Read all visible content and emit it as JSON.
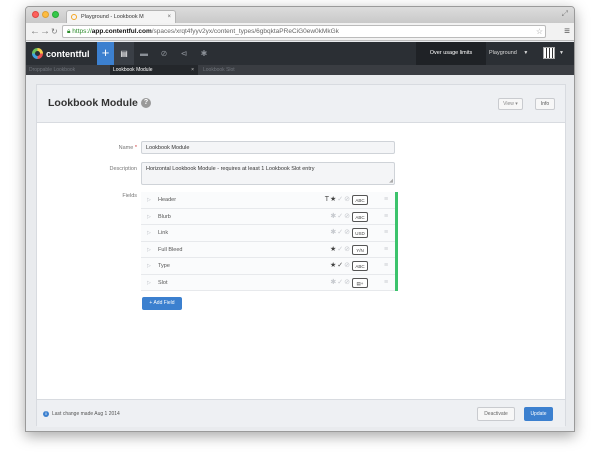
{
  "browser": {
    "tab_title": "Playground - Lookbook M",
    "tab_close": "×",
    "url_scheme": "https://",
    "url_host": "app.contentful.com",
    "url_path": "/spaces/xrqt4fyyv2yx/content_types/6gbqktaPReCiG0ew0kMkGk"
  },
  "app": {
    "brand": "contentful",
    "usage_limits": "Over usage limits",
    "space_name": "Playground"
  },
  "entity_tabs": [
    {
      "label": "Droppable Lookbook"
    },
    {
      "label": "Lookbook Module",
      "close": "×"
    },
    {
      "label": "Lookbook Slot"
    }
  ],
  "content_type": {
    "title": "Lookbook Module",
    "view_button": "View ▾",
    "info_button": "Info",
    "name_label": "Name",
    "name_required": "*",
    "name_value": "Lookbook Module",
    "description_label": "Description",
    "description_value": "Horizontal Lookbook Module - requires at least 1 Lookbook Slot entry",
    "fields_label": "Fields",
    "add_field_button": "+ Add Field"
  },
  "fields": [
    {
      "name": "Header",
      "type": "ABC",
      "title": true,
      "required": true,
      "localized": false,
      "disabled": false
    },
    {
      "name": "Blurb",
      "type": "ABC",
      "title": false,
      "required": false,
      "localized": false,
      "disabled": false
    },
    {
      "name": "Link",
      "type": "USD",
      "title": false,
      "required": false,
      "localized": false,
      "disabled": false
    },
    {
      "name": "Full Bleed",
      "type": "Y/N",
      "title": false,
      "required": true,
      "localized": false,
      "disabled": false
    },
    {
      "name": "Type",
      "type": "ABC",
      "title": false,
      "required": true,
      "localized": true,
      "disabled": false
    },
    {
      "name": "Slot",
      "type": "▤+",
      "title": false,
      "required": false,
      "localized": false,
      "disabled": false
    }
  ],
  "footer": {
    "last_change": "Last change made Aug 1 2014",
    "deactivate_button": "Deactivate",
    "update_button": "Update"
  },
  "colors": {
    "accent": "#3c80cf",
    "header_bg": "#2b2f34",
    "field_status": "#3cc36c"
  }
}
